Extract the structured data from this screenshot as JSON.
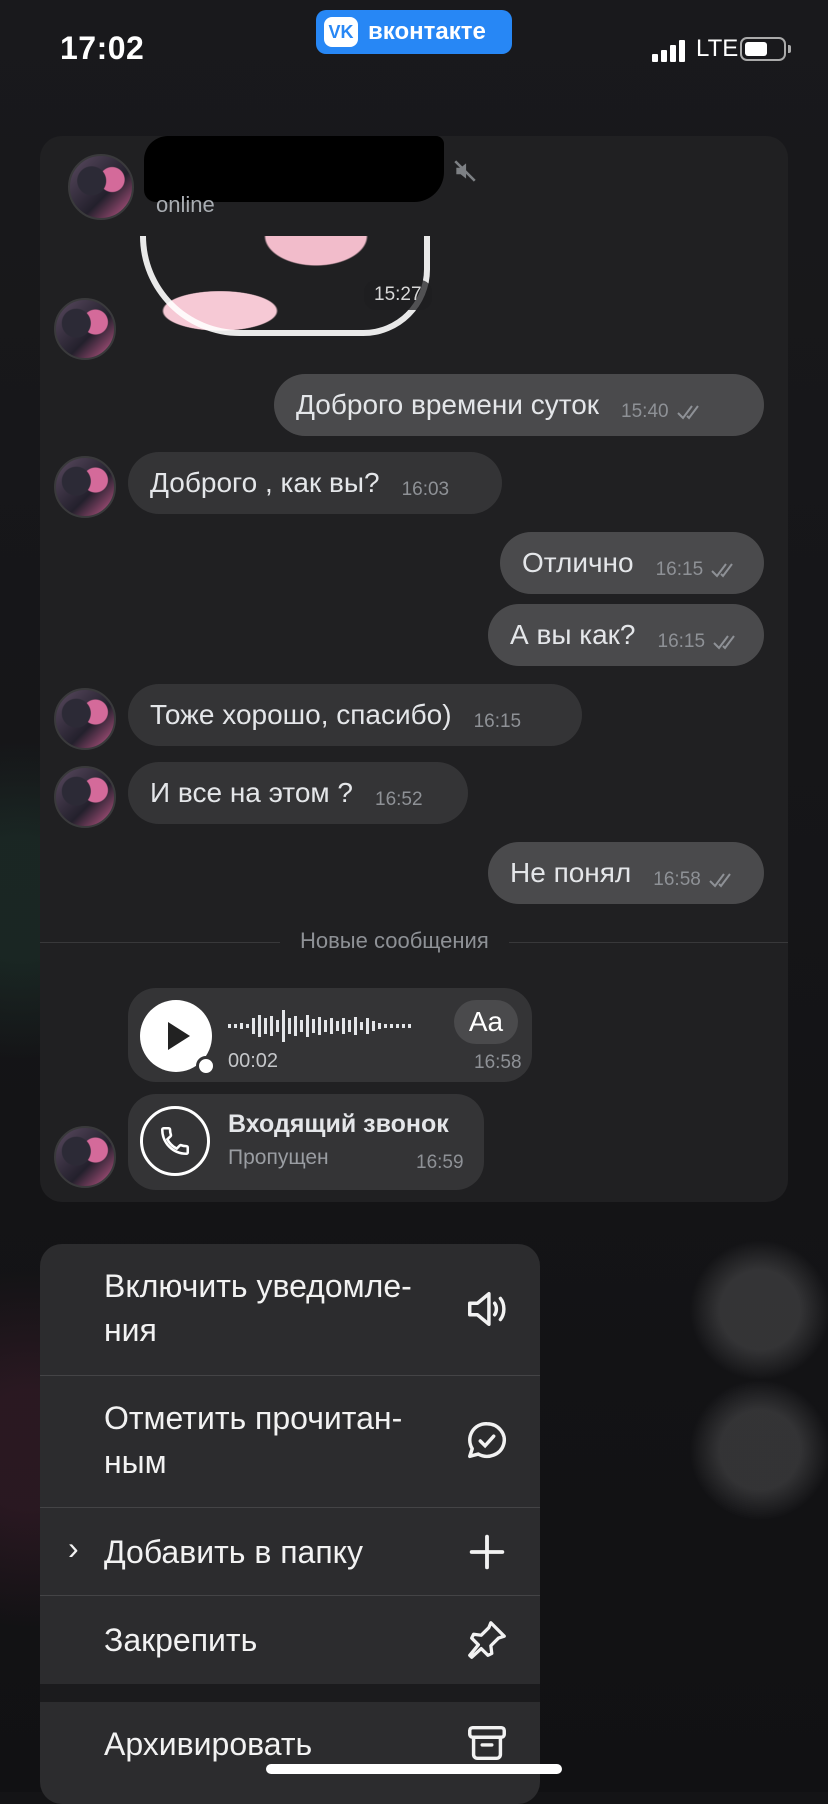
{
  "status_bar": {
    "time": "17:02",
    "app_badge": "вконтакте",
    "app_badge_logo": "VK",
    "network": "LTE"
  },
  "chat": {
    "status": "online",
    "sticker_time": "15:27",
    "messages": [
      {
        "direction": "out",
        "text": "Доброго времени суток",
        "time": "15:40",
        "read": true
      },
      {
        "direction": "in",
        "text": "Доброго , как вы?",
        "time": "16:03"
      },
      {
        "direction": "out",
        "text": "Отлично",
        "time": "16:15",
        "read": true
      },
      {
        "direction": "out",
        "text": "А вы как?",
        "time": "16:15",
        "read": true
      },
      {
        "direction": "in",
        "text": "Тоже хорошо, спасибо)",
        "time": "16:15"
      },
      {
        "direction": "in",
        "text": "И все на этом ?",
        "time": "16:52"
      },
      {
        "direction": "out",
        "text": "Не понял",
        "time": "16:58",
        "read": true
      }
    ],
    "new_messages_divider": "Новые сообщения",
    "voice_message": {
      "duration": "00:02",
      "time": "16:58",
      "transcribe_label": "Aa"
    },
    "call": {
      "title": "Входящий звонок",
      "subtitle": "Пропущен",
      "time": "16:59"
    }
  },
  "menu": {
    "items": [
      {
        "label_line1": "Включить уведомле-",
        "label_line2": "ния",
        "icon": "speaker-icon"
      },
      {
        "label_line1": "Отметить прочитан-",
        "label_line2": "ным",
        "icon": "read-check-icon"
      },
      {
        "label": "Добавить в папку",
        "icon": "plus-icon",
        "has_submenu": true
      },
      {
        "label": "Закрепить",
        "icon": "pin-icon"
      },
      {
        "label": "Архивировать",
        "icon": "archive-icon"
      }
    ]
  },
  "colors": {
    "vk_blue": "#2787f5",
    "bubble_in": "#343436",
    "bubble_out": "#4a4a4c",
    "menu_bg": "#2c2c2e"
  }
}
